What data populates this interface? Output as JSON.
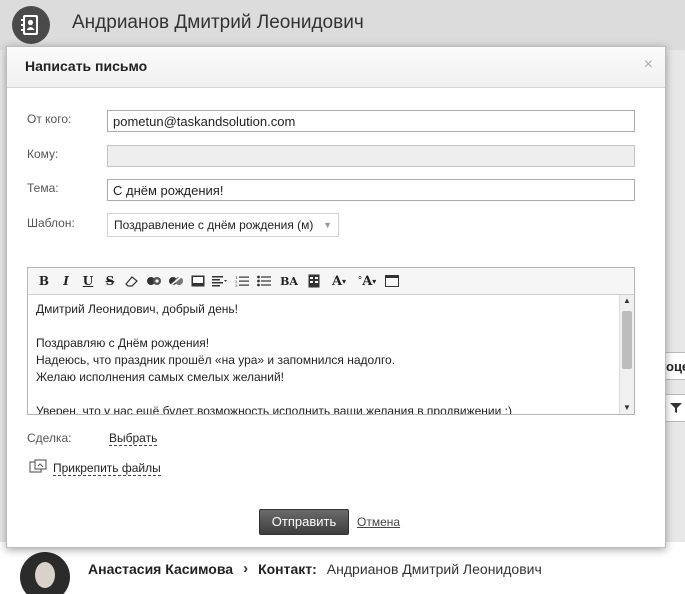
{
  "page": {
    "title": "Андрианов Дмитрий Леонидович"
  },
  "modal": {
    "title": "Написать письмо",
    "close_icon": "×",
    "from_label": "От кого:",
    "from_value": "pometun@taskandsolution.com",
    "to_label": "Кому:",
    "to_value": "",
    "subject_label": "Тема:",
    "subject_value": "С днём рождения!",
    "template_label": "Шаблон:",
    "template_value": "Поздравление с днём рождения (м)",
    "editor": {
      "toolbar": [
        "B",
        "I",
        "U",
        "S",
        "eraser",
        "link",
        "unlink",
        "image",
        "align",
        "ordered-list",
        "unordered-list",
        "font-size",
        "table",
        "font-color",
        "font-bg",
        "source"
      ],
      "lines": [
        "Дмитрий Леонидович, добрый день!",
        "",
        "Поздравляю с Днём рождения!",
        "Надеюсь, что праздник прошёл «на ура» и запомнился надолго.",
        "Желаю исполнения самых смелых желаний!",
        "",
        "Уверен, что у нас ещё будет возможность исполнить ваши желания в продвижении :)"
      ]
    },
    "deal_label": "Сделка:",
    "deal_link": "Выбрать",
    "attach_label": "Прикрепить файлы",
    "send_label": "Отправить",
    "cancel_label": "Отмена"
  },
  "background": {
    "right_button_text": "оце",
    "breadcrumb": {
      "user": "Анастасия Касимова",
      "separator": "›",
      "contact_label": "Контакт:",
      "contact_value": "Андрианов Дмитрий Леонидович"
    }
  },
  "colors": {
    "send_button": "#4a4a4a",
    "header_bg": "#dcdcdc"
  }
}
